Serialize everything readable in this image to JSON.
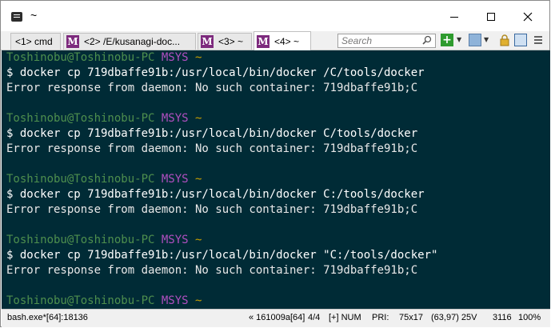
{
  "window": {
    "title": "~"
  },
  "tabs": [
    {
      "label": "<1> cmd",
      "icon": "",
      "active": false
    },
    {
      "label": "<2> /E/kusanagi-doc...",
      "icon": "msys-icon",
      "active": false
    },
    {
      "label": "<3> ~",
      "icon": "msys-icon",
      "active": false
    },
    {
      "label": "<4> ~",
      "icon": "msys-icon",
      "active": true
    }
  ],
  "msys_icon_letter": "M",
  "toolbar": {
    "search_placeholder": "Search",
    "plus_icon": "+",
    "dropdown_arrow": "▼"
  },
  "terminal": {
    "prompt_user": "Toshinobu@Toshinobu-PC",
    "prompt_system": "MSYS",
    "prompt_path": "~",
    "blocks": [
      {
        "command": "$ docker cp 719dbaffe91b:/usr/local/bin/docker /C/tools/docker",
        "output": "Error response from daemon: No such container: 719dbaffe91b;C"
      },
      {
        "command": "$ docker cp 719dbaffe91b:/usr/local/bin/docker C/tools/docker",
        "output": "Error response from daemon: No such container: 719dbaffe91b;C"
      },
      {
        "command": "$ docker cp 719dbaffe91b:/usr/local/bin/docker C:/tools/docker",
        "output": "Error response from daemon: No such container: 719dbaffe91b;C"
      },
      {
        "command": "$ docker cp 719dbaffe91b:/usr/local/bin/docker \"C:/tools/docker\"",
        "output": "Error response from daemon: No such container: 719dbaffe91b;C"
      }
    ]
  },
  "status": {
    "process": "bash.exe*[64]:18136",
    "pid_info": "« 161009a[64]",
    "console": "4/4",
    "mode": "[+] NUM",
    "priority": "PRI:",
    "size": "75x17",
    "position": "(63,97) 25V",
    "number": "3116",
    "zoom": "100%"
  },
  "colors": {
    "terminal_bg": "#002b36",
    "prompt_user": "#4e8f4e",
    "prompt_system": "#b04fc0",
    "prompt_path": "#c8a000",
    "msys_icon": "#7d2a7d"
  }
}
